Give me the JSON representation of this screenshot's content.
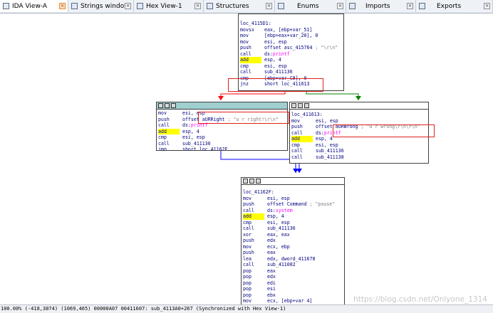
{
  "tabs": [
    {
      "label": "IDA View-A",
      "active": true
    },
    {
      "label": "Strings window"
    },
    {
      "label": "Hex View-1"
    },
    {
      "label": "Structures"
    },
    {
      "label": "Enums"
    },
    {
      "label": "Imports"
    },
    {
      "label": "Exports"
    }
  ],
  "blocks": {
    "top": {
      "label": "loc_4115D1:",
      "rows": [
        {
          "m": "movsx",
          "o": "eax, [ebp+var_51]"
        },
        {
          "m": "mov",
          "o": "[ebp+eax+var_20], 0"
        },
        {
          "m": "mov",
          "o": "esi, esp"
        },
        {
          "m": "push",
          "o": "offset asc_415764",
          "c": "; \"\\r\\n\""
        },
        {
          "m": "call",
          "o": "ds:",
          "f": "printf"
        },
        {
          "m": "add",
          "o": "esp, 4",
          "hl": true
        },
        {
          "m": "cmp",
          "o": "esi, esp"
        },
        {
          "m": "call",
          "o": "sub_411136"
        },
        {
          "m": "cmp",
          "o": "[ebp+var_C8], 0"
        },
        {
          "m": "jnz",
          "o": "short loc_411613"
        }
      ]
    },
    "left": {
      "rows": [
        {
          "m": "mov",
          "o": "esi, esp"
        },
        {
          "m": "push",
          "o": "offset aURRight",
          "c": "; \"u r right!\\r\\n\""
        },
        {
          "m": "call",
          "o": "ds:",
          "f": "printf"
        },
        {
          "m": "add",
          "o": "esp, 4",
          "hl": true
        },
        {
          "m": "cmp",
          "o": "esi, esp"
        },
        {
          "m": "call",
          "o": "sub_411136"
        },
        {
          "m": "jmp",
          "o": "short loc_41162F"
        }
      ]
    },
    "right": {
      "label": "loc_411613:",
      "rows": [
        {
          "m": "mov",
          "o": "esi, esp"
        },
        {
          "m": "push",
          "o": "offset aURWrong",
          "c": "; \"u r wrong\\r\\n\\r\\n\""
        },
        {
          "m": "call",
          "o": "ds:",
          "f": "printf"
        },
        {
          "m": "add",
          "o": "esp, 4",
          "hl": true
        },
        {
          "m": "cmp",
          "o": "esi, esp"
        },
        {
          "m": "call",
          "o": "sub_411136"
        },
        {
          "m": "call",
          "o": "sub_411138"
        }
      ]
    },
    "bottom": {
      "label": "loc_41162F:",
      "rows": [
        {
          "m": "mov",
          "o": "esi, esp"
        },
        {
          "m": "push",
          "o": "offset Command",
          "c": "; \"pause\""
        },
        {
          "m": "call",
          "o": "ds:",
          "f": "system"
        },
        {
          "m": "add",
          "o": "esp, 4",
          "hl": true
        },
        {
          "m": "cmp",
          "o": "esi, esp"
        },
        {
          "m": "call",
          "o": "sub_411136"
        },
        {
          "m": "xor",
          "o": "eax, eax"
        },
        {
          "m": "push",
          "o": "edx"
        },
        {
          "m": "mov",
          "o": "ecx, ebp"
        },
        {
          "m": "push",
          "o": "eax"
        },
        {
          "m": "lea",
          "o": "edx, dword_411678"
        },
        {
          "m": "call",
          "o": "sub_411082"
        },
        {
          "m": "pop",
          "o": "eax"
        },
        {
          "m": "pop",
          "o": "edx"
        },
        {
          "m": "pop",
          "o": "edi"
        },
        {
          "m": "pop",
          "o": "esi"
        },
        {
          "m": "pop",
          "o": "ebx"
        },
        {
          "m": "mov",
          "o": "ecx, [ebp+var 4]"
        }
      ]
    }
  },
  "status": "100.00% (-418,3074) (1069,465) 00000A07 00411607: sub_4113A0+267 (Synchronized with Hex View-1)",
  "watermark": "https://blog.csdn.net/Onlyone_1314",
  "colors": {
    "block_header": "#9fcfcf",
    "highlight": "#ffff00",
    "true_edge": "#008000",
    "false_edge": "#ff0000",
    "jump_edge": "#0000ff",
    "annotation": "#e02020"
  }
}
